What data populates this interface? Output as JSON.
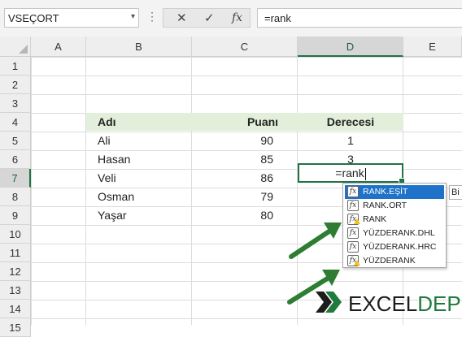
{
  "formula_bar": {
    "name_box": "VSEÇORT",
    "name_box_arrow": "▾",
    "separator": "⋮",
    "cancel_glyph": "✕",
    "enter_glyph": "✓",
    "fx_glyph": "fx",
    "formula_text": "=rank"
  },
  "columns": [
    "A",
    "B",
    "C",
    "D",
    "E"
  ],
  "rows": [
    "1",
    "2",
    "3",
    "4",
    "5",
    "6",
    "7",
    "8",
    "9",
    "10",
    "11",
    "12",
    "13",
    "14",
    "15"
  ],
  "table": {
    "headers": {
      "name": "Adı",
      "score": "Puanı",
      "rank": "Derecesi"
    },
    "rows": [
      {
        "name": "Ali",
        "score": "90",
        "rank": "1"
      },
      {
        "name": "Hasan",
        "score": "85",
        "rank": "3"
      },
      {
        "name": "Veli",
        "score": "86",
        "rank": "=rank"
      },
      {
        "name": "Osman",
        "score": "79",
        "rank": ""
      },
      {
        "name": "Yaşar",
        "score": "80",
        "rank": ""
      }
    ]
  },
  "autocomplete": {
    "items": [
      {
        "label": "RANK.EŞİT",
        "icon": "function-icon",
        "warning": false,
        "selected": true
      },
      {
        "label": "RANK.ORT",
        "icon": "function-icon",
        "warning": false,
        "selected": false
      },
      {
        "label": "RANK",
        "icon": "function-warning-icon",
        "warning": true,
        "selected": false
      },
      {
        "label": "YÜZDERANK.DHL",
        "icon": "function-icon",
        "warning": false,
        "selected": false
      },
      {
        "label": "YÜZDERANK.HRC",
        "icon": "function-icon",
        "warning": false,
        "selected": false
      },
      {
        "label": "YÜZDERANK",
        "icon": "function-warning-icon",
        "warning": true,
        "selected": false
      }
    ],
    "tooltip_text": "Bi"
  },
  "logo": {
    "part1": "EXCEL",
    "part2": "DEPO"
  },
  "colors": {
    "accent_green": "#217346",
    "header_band": "#e2efda",
    "selection_blue": "#1e73c8",
    "arrow_green": "#2e7d32"
  }
}
